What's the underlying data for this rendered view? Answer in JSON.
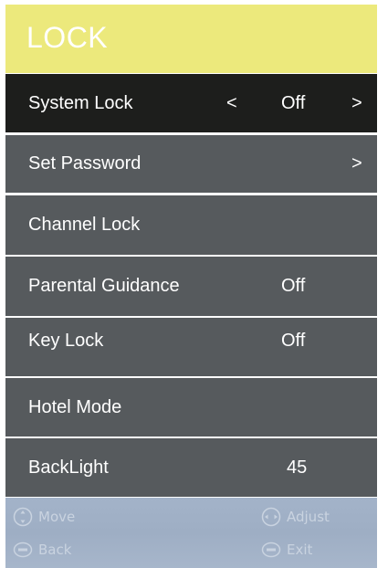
{
  "header": {
    "title": "LOCK"
  },
  "menu": {
    "items": [
      {
        "label": "System Lock",
        "left_arrow": "<",
        "value": "Off",
        "right_arrow": ">"
      },
      {
        "label": "Set Password",
        "right_arrow": ">"
      },
      {
        "label": "Channel Lock"
      },
      {
        "label": "Parental Guidance",
        "value": "Off"
      },
      {
        "label": "Key Lock",
        "value": "Off"
      },
      {
        "label": "Hotel Mode"
      },
      {
        "label": "BackLight",
        "value": "45"
      }
    ]
  },
  "footer": {
    "move": "Move",
    "adjust": "Adjust",
    "back": "Back",
    "exit": "Exit"
  },
  "colors": {
    "header_bg": "#ece97c",
    "selected_row_bg": "#1d1e1c",
    "row_bg": "#565a5d",
    "footer_bg": "#a3b3c9"
  },
  "icons": {
    "move": "dpad-icon",
    "adjust": "left-right-icon",
    "back": "menu-key-icon",
    "exit": "exit-key-icon"
  }
}
